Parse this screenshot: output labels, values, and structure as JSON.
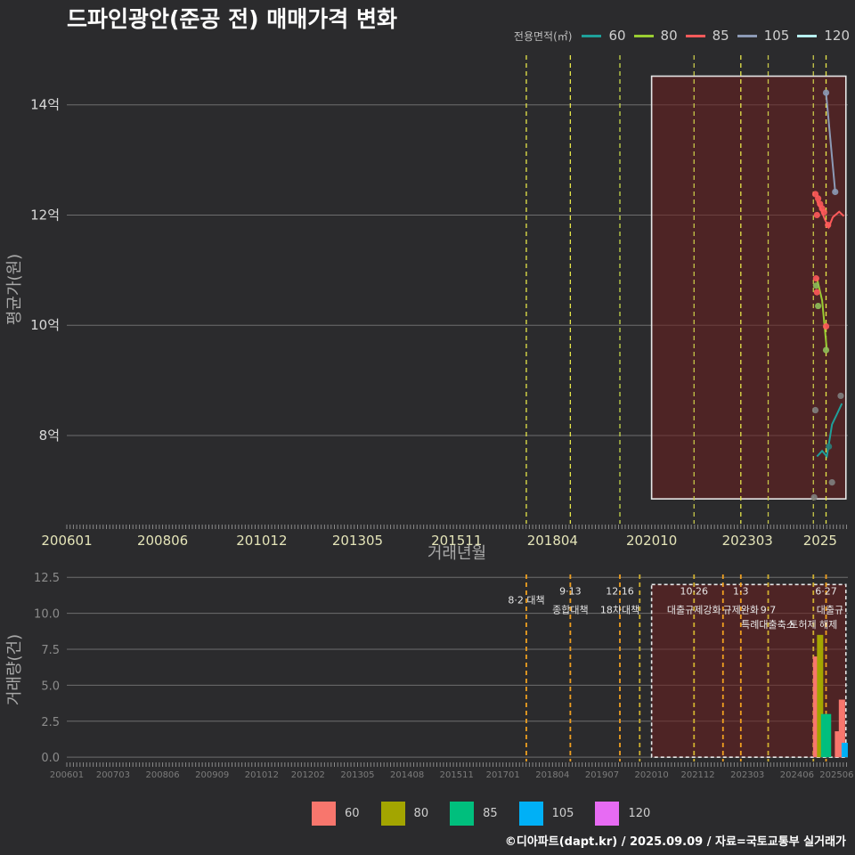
{
  "title": "드파인광안(준공 전) 매매가격 변화",
  "legend_top": {
    "title": "전용면적(㎡)",
    "items": [
      {
        "label": "60",
        "color": "#1fa09a"
      },
      {
        "label": "80",
        "color": "#9acd32"
      },
      {
        "label": "85",
        "color": "#ff5a5a"
      },
      {
        "label": "105",
        "color": "#8c9ab5"
      },
      {
        "label": "120",
        "color": "#b7f0f0"
      }
    ]
  },
  "legend_bottom": {
    "items": [
      {
        "label": "60",
        "color": "#f8766d"
      },
      {
        "label": "80",
        "color": "#a3a500"
      },
      {
        "label": "85",
        "color": "#00bf7d"
      },
      {
        "label": "105",
        "color": "#00b0f6"
      },
      {
        "label": "120",
        "color": "#e76bf3"
      }
    ]
  },
  "credit": "©디아파트(dapt.kr) / 2025.09.09 / 자료=국토교통부 실거래가",
  "chart_data": [
    {
      "type": "line",
      "xlabel": "거래년월",
      "ylabel": "평균가(원)",
      "x_ticks": [
        "200601",
        "200806",
        "201012",
        "201305",
        "201511",
        "201804",
        "202010",
        "202303",
        "2025"
      ],
      "y_ticks": [
        {
          "v": 8,
          "label": "8억"
        },
        {
          "v": 10,
          "label": "10억"
        },
        {
          "v": 12,
          "label": "12억"
        },
        {
          "v": 14,
          "label": "14억"
        }
      ],
      "ylim": [
        6.4,
        14.9
      ],
      "x_range": [
        2006.0,
        2025.7
      ],
      "policy_lines": [
        {
          "x": 2017.59,
          "color": "#e8e84a"
        },
        {
          "x": 2018.7,
          "color": "#e8e84a"
        },
        {
          "x": 2019.95,
          "color": "#c8d84a"
        },
        {
          "x": 2021.82,
          "color": "#c8c84a"
        },
        {
          "x": 2023.0,
          "color": "#e8e84a"
        },
        {
          "x": 2023.69,
          "color": "#c8c84a"
        },
        {
          "x": 2024.83,
          "color": "#c8c84a"
        },
        {
          "x": 2025.15,
          "color": "#e8e84a"
        }
      ],
      "highlight_box": {
        "x0": 2020.75,
        "x1": 2025.65,
        "y0": 6.85,
        "y1": 14.52
      },
      "series": [
        {
          "name": "60",
          "color": "#1fa09a",
          "points": [
            [
              2024.92,
              7.62
            ],
            [
              2025.05,
              7.72
            ],
            [
              2025.17,
              7.62
            ],
            [
              2025.3,
              8.2
            ],
            [
              2025.42,
              8.38
            ],
            [
              2025.55,
              8.58
            ]
          ]
        },
        {
          "name": "80",
          "color": "#9acd32",
          "points": [
            [
              2024.92,
              10.85
            ],
            [
              2025.05,
              10.45
            ],
            [
              2025.17,
              9.55
            ]
          ]
        },
        {
          "name": "85",
          "color": "#ff5a5a",
          "points": [
            [
              2024.92,
              12.25
            ],
            [
              2025.02,
              12.1
            ],
            [
              2025.12,
              11.92
            ],
            [
              2025.22,
              11.78
            ],
            [
              2025.32,
              11.96
            ],
            [
              2025.48,
              12.06
            ],
            [
              2025.6,
              11.98
            ]
          ]
        },
        {
          "name": "105",
          "color": "#8c9ab5",
          "points": [
            [
              2025.15,
              14.22
            ],
            [
              2025.38,
              12.42
            ]
          ]
        }
      ],
      "scatter": [
        {
          "x": 2024.85,
          "y": 6.88,
          "color": "#7f7f7f"
        },
        {
          "x": 2024.88,
          "y": 8.46,
          "color": "#7f7f7f"
        },
        {
          "x": 2025.3,
          "y": 7.15,
          "color": "#7f7f7f"
        },
        {
          "x": 2025.52,
          "y": 8.72,
          "color": "#7f7f7f"
        },
        {
          "x": 2025.22,
          "y": 7.8,
          "color": "#2a7f7a"
        },
        {
          "x": 2024.9,
          "y": 10.85,
          "color": "#ff5a5a"
        },
        {
          "x": 2024.9,
          "y": 10.72,
          "color": "#8fbf5a"
        },
        {
          "x": 2024.92,
          "y": 10.6,
          "color": "#ff5a5a"
        },
        {
          "x": 2024.95,
          "y": 10.35,
          "color": "#8fbf5a"
        },
        {
          "x": 2025.15,
          "y": 9.98,
          "color": "#ff5a5a"
        },
        {
          "x": 2025.15,
          "y": 9.55,
          "color": "#8fbf5a"
        },
        {
          "x": 2024.88,
          "y": 12.38,
          "color": "#ff5a5a"
        },
        {
          "x": 2024.95,
          "y": 12.3,
          "color": "#ff5a5a"
        },
        {
          "x": 2025.0,
          "y": 12.2,
          "color": "#ff5a5a"
        },
        {
          "x": 2025.05,
          "y": 12.12,
          "color": "#ff5a5a"
        },
        {
          "x": 2025.1,
          "y": 12.05,
          "color": "#ff5a5a"
        },
        {
          "x": 2024.92,
          "y": 12.0,
          "color": "#ff5a5a"
        },
        {
          "x": 2025.2,
          "y": 11.82,
          "color": "#ff5a5a"
        },
        {
          "x": 2025.15,
          "y": 14.22,
          "color": "#8c9ab5"
        },
        {
          "x": 2025.38,
          "y": 12.42,
          "color": "#8c9ab5"
        }
      ]
    },
    {
      "type": "bar",
      "ylabel": "거래량(건)",
      "x_ticks": [
        "200601",
        "200703",
        "200806",
        "200909",
        "201012",
        "201202",
        "201305",
        "201408",
        "201511",
        "201701",
        "201804",
        "201907",
        "202010",
        "202112",
        "202303",
        "202406",
        "202506"
      ],
      "y_ticks": [
        {
          "v": 0,
          "label": "0.0"
        },
        {
          "v": 2.5,
          "label": "2.5"
        },
        {
          "v": 5,
          "label": "5.0"
        },
        {
          "v": 7.5,
          "label": "7.5"
        },
        {
          "v": 10,
          "label": "10.0"
        },
        {
          "v": 12.5,
          "label": "12.5"
        }
      ],
      "ylim": [
        -0.3,
        12.7
      ],
      "x_range": [
        2006.0,
        2025.7
      ],
      "policy_lines": [
        {
          "x": 2017.59,
          "color": "#f0a020"
        },
        {
          "x": 2018.7,
          "color": "#f0a020"
        },
        {
          "x": 2019.95,
          "color": "#f0a020"
        },
        {
          "x": 2020.45,
          "color": "#d0b030"
        },
        {
          "x": 2021.82,
          "color": "#d0b030"
        },
        {
          "x": 2022.55,
          "color": "#f0a020"
        },
        {
          "x": 2023.0,
          "color": "#f0a020"
        },
        {
          "x": 2023.69,
          "color": "#d0b030"
        },
        {
          "x": 2024.83,
          "color": "#d0b030"
        },
        {
          "x": 2025.15,
          "color": "#f0a020"
        }
      ],
      "highlight_box": {
        "x0": 2020.75,
        "x1": 2025.65,
        "y0": 0.0,
        "y1": 12.0
      },
      "annotations": [
        {
          "text": "8·2 대책",
          "x": 2017.59,
          "y": 10.7
        },
        {
          "text": "9·13",
          "x": 2018.7,
          "y": 11.3
        },
        {
          "text": "종합대책",
          "x": 2018.7,
          "y": 10.0
        },
        {
          "text": "12·16",
          "x": 2019.95,
          "y": 11.3
        },
        {
          "text": "18차대책",
          "x": 2019.95,
          "y": 10.0
        },
        {
          "text": "10·26",
          "x": 2021.82,
          "y": 11.3
        },
        {
          "text": "대출규제강화",
          "x": 2021.82,
          "y": 10.0
        },
        {
          "text": "1·3",
          "x": 2023.0,
          "y": 11.3
        },
        {
          "text": "규제완화",
          "x": 2023.0,
          "y": 10.0
        },
        {
          "text": "9·7",
          "x": 2023.69,
          "y": 10.0
        },
        {
          "text": "특례대출축소",
          "x": 2023.69,
          "y": 9.0
        },
        {
          "text": "토허제 해제",
          "x": 2024.83,
          "y": 9.0
        },
        {
          "text": "6·27",
          "x": 2025.15,
          "y": 11.3
        },
        {
          "text": "대출규",
          "x": 2025.25,
          "y": 10.0
        }
      ],
      "bars": [
        {
          "x": 2024.9,
          "value": 7.0,
          "series": "85",
          "color": "#f8766d"
        },
        {
          "x": 2025.0,
          "value": 8.5,
          "series": "80",
          "color": "#a3a500"
        },
        {
          "x": 2025.1,
          "value": 3.0,
          "series": "85",
          "color": "#00bf7d"
        },
        {
          "x": 2025.2,
          "value": 3.0,
          "series": "85",
          "color": "#00bf7d"
        },
        {
          "x": 2025.45,
          "value": 1.8,
          "series": "60",
          "color": "#f8766d"
        },
        {
          "x": 2025.55,
          "value": 4.0,
          "series": "60",
          "color": "#f8766d"
        },
        {
          "x": 2025.62,
          "value": 1.0,
          "series": "105",
          "color": "#00b0f6"
        }
      ]
    }
  ]
}
